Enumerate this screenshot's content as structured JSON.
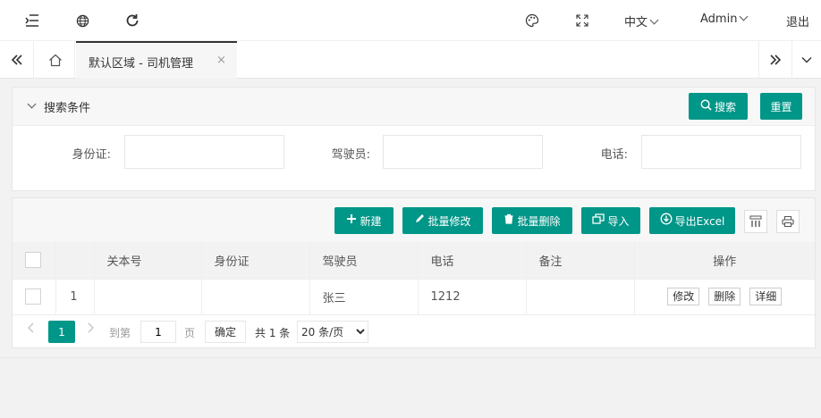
{
  "topbar": {
    "icons": [
      "menu-fold-icon",
      "globe-icon",
      "refresh-icon",
      "palette-icon",
      "fullscreen-icon"
    ],
    "lang_label": "中文",
    "user_label": "Admin",
    "logout_label": "退出"
  },
  "tabs": {
    "active_label": "默认区域 - 司机管理",
    "close": "×"
  },
  "search": {
    "title": "搜索条件",
    "search_button": "搜索",
    "reset_button": "重置",
    "fields": [
      {
        "label": "身份证:",
        "value": ""
      },
      {
        "label": "驾驶员:",
        "value": ""
      },
      {
        "label": "电话:",
        "value": ""
      }
    ]
  },
  "toolbar": {
    "new": "新建",
    "batch_edit": "批量修改",
    "batch_delete": "批量删除",
    "import": "导入",
    "export": "导出Excel"
  },
  "table": {
    "columns": [
      "关本号",
      "身份证",
      "驾驶员",
      "电话",
      "备注",
      "操作"
    ],
    "rows": [
      {
        "index": "1",
        "cols": [
          "",
          "",
          "张三",
          "1212",
          ""
        ]
      }
    ],
    "actions": [
      "修改",
      "删除",
      "详细"
    ]
  },
  "pager": {
    "current": "1",
    "goto_prefix": "到第",
    "goto_value": "1",
    "goto_suffix": "页",
    "confirm": "确定",
    "total": "共 1 条",
    "page_size": "20 条/页"
  },
  "colors": {
    "accent": "#009688"
  }
}
